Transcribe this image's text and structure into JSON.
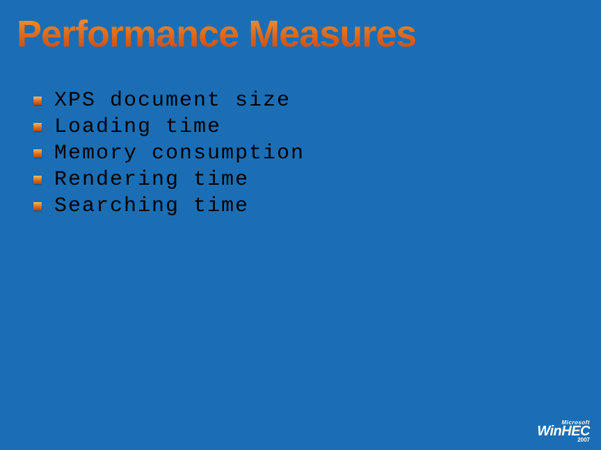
{
  "title": "Performance Measures",
  "bullets": [
    "XPS document size",
    "Loading time",
    "Memory consumption",
    "Rendering time",
    "Searching time"
  ],
  "footer": {
    "brand": "Microsoft",
    "event": "WinHEC",
    "year": "2007"
  }
}
